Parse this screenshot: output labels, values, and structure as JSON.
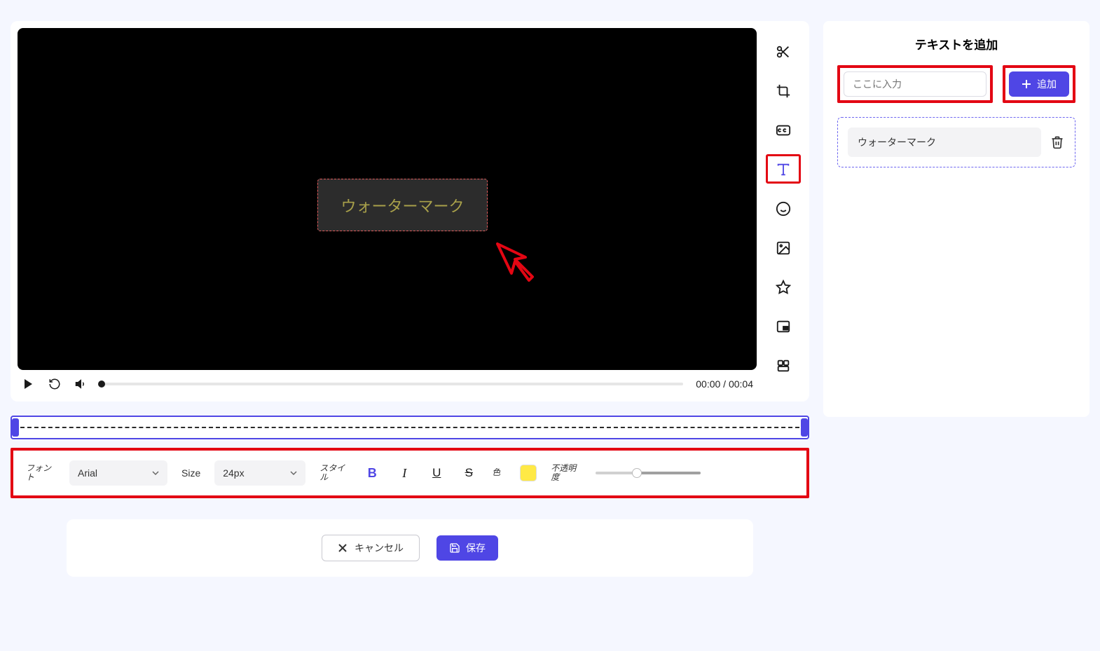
{
  "preview": {
    "watermark_text": "ウォーターマーク",
    "time_display": "00:00 / 00:04"
  },
  "rail": {
    "cut": "cut",
    "crop": "crop",
    "cc": "cc",
    "text": "text",
    "emoji": "emoji",
    "image": "image",
    "star": "star",
    "pip": "pip",
    "arrange": "arrange"
  },
  "styles": {
    "font_label": "フォント",
    "font_value": "Arial",
    "size_label": "Size",
    "size_value": "24px",
    "style_label": "スタイル",
    "color_label": "色",
    "opacity_label": "不透明度",
    "color_swatch": "#ffe946"
  },
  "right": {
    "title": "テキストを追加",
    "input_placeholder": "ここに入力",
    "add_label": "追加",
    "items": [
      {
        "text": "ウォーターマーク"
      }
    ]
  },
  "footer": {
    "cancel": "キャンセル",
    "save": "保存"
  }
}
